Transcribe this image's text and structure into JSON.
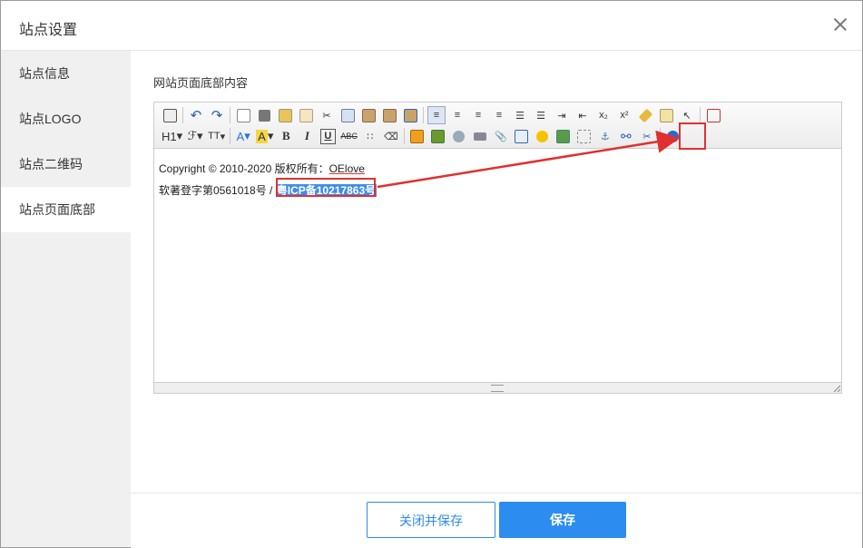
{
  "dialog": {
    "title": "站点设置"
  },
  "sidebar": {
    "items": [
      {
        "label": "站点信息"
      },
      {
        "label": "站点LOGO"
      },
      {
        "label": "站点二维码"
      },
      {
        "label": "站点页面底部"
      }
    ]
  },
  "main": {
    "section_label": "网站页面底部内容"
  },
  "toolbar": {
    "heading": "H1",
    "font_family": "ℱ",
    "font_size": "TT",
    "font_color": "A",
    "bg_color": "A",
    "bold": "B",
    "italic": "I",
    "underline": "U",
    "strike": "ABC",
    "subscript": "x₂",
    "superscript": "x²"
  },
  "content": {
    "line1_prefix": "Copyright © 2010-2020   版权所有：",
    "owner_link": "OElove",
    "line2_prefix": "软著登字第0561018号 / ",
    "icp_link": "粤ICP备10217863号"
  },
  "footer": {
    "close_save_label": "关闭并保存",
    "save_label": "保存"
  },
  "colors": {
    "accent": "#2d8cf0",
    "annotation": "#e03030"
  }
}
